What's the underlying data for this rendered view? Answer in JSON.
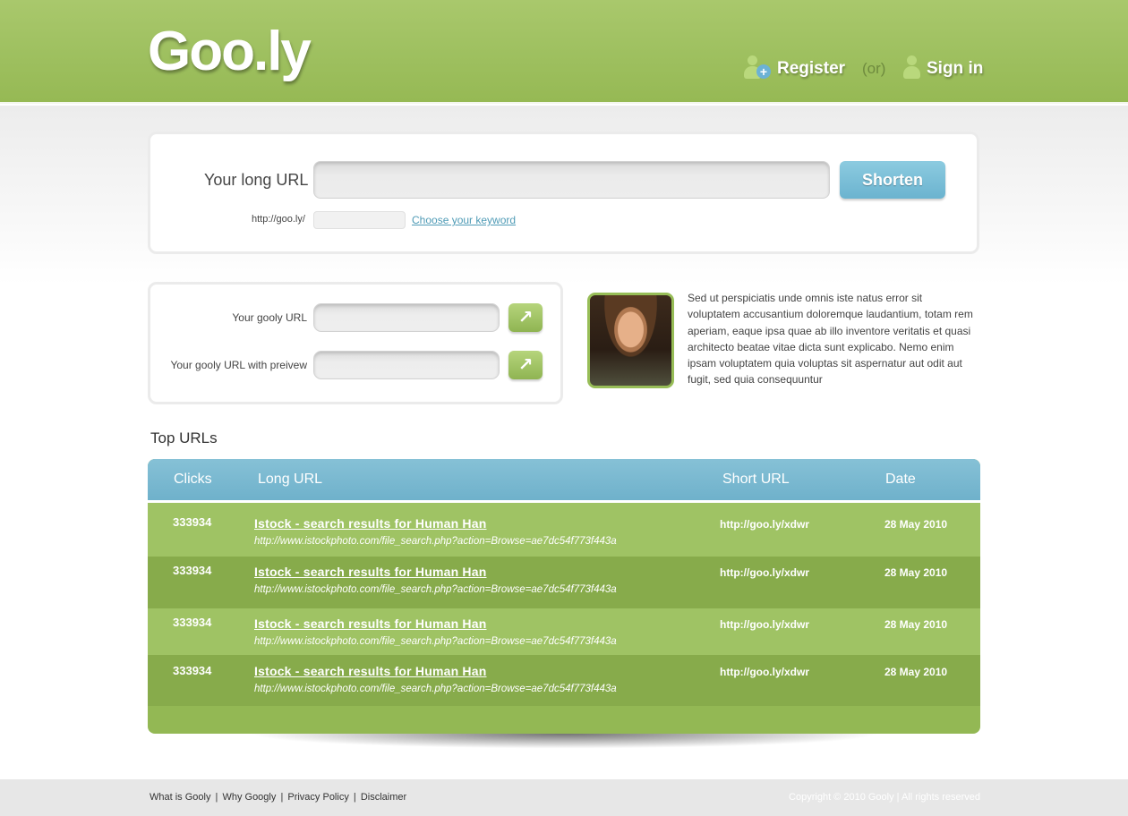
{
  "header": {
    "logo": "Goo.ly",
    "register_label": "Register",
    "or_label": "(or)",
    "signin_label": "Sign in"
  },
  "shorten": {
    "long_url_label": "Your long URL",
    "button_label": "Shorten",
    "prefix": "http://goo.ly/",
    "keyword_link": "Choose your keyword"
  },
  "gooly": {
    "url_label": "Your gooly URL",
    "preview_label": "Your gooly URL with preivew",
    "go_symbol": "↗"
  },
  "bio": {
    "text": "Sed ut perspiciatis unde omnis iste natus error sit voluptatem accusantium doloremque laudantium, totam rem aperiam, eaque ipsa quae ab illo inventore veritatis et quasi architecto beatae vitae dicta sunt explicabo. Nemo enim ipsam voluptatem quia voluptas sit aspernatur aut odit aut fugit, sed quia consequuntur"
  },
  "top_urls": {
    "title": "Top URLs",
    "columns": [
      "Clicks",
      "Long URL",
      "Short URL",
      "Date"
    ],
    "rows": [
      {
        "clicks": "333934",
        "title": "Istock - search results for Human Han",
        "url": "http://www.istockphoto.com/file_search.php?action=Browse=ae7dc54f773f443a",
        "short": "http://goo.ly/xdwr",
        "date": "28 May 2010"
      },
      {
        "clicks": "333934",
        "title": "Istock - search results for Human Han",
        "url": "http://www.istockphoto.com/file_search.php?action=Browse=ae7dc54f773f443a",
        "short": "http://goo.ly/xdwr",
        "date": "28 May 2010"
      },
      {
        "clicks": "333934",
        "title": "Istock - search results for Human Han",
        "url": "http://www.istockphoto.com/file_search.php?action=Browse=ae7dc54f773f443a",
        "short": "http://goo.ly/xdwr",
        "date": "28 May 2010"
      },
      {
        "clicks": "333934",
        "title": "Istock - search results for Human Han",
        "url": "http://www.istockphoto.com/file_search.php?action=Browse=ae7dc54f773f443a",
        "short": "http://goo.ly/xdwr",
        "date": "28 May 2010"
      }
    ]
  },
  "footer": {
    "links": [
      "What is Gooly",
      "Why Googly",
      "Privacy Policy",
      "Disclaimer"
    ],
    "separator": "|",
    "copyright": "Copyright © 2010 Gooly  |  All rights reserved"
  },
  "colors": {
    "header_green": "#9dbf5e",
    "accent_blue": "#6fb1cb",
    "row_light": "#9fc364",
    "row_dark": "#87ab4b"
  }
}
